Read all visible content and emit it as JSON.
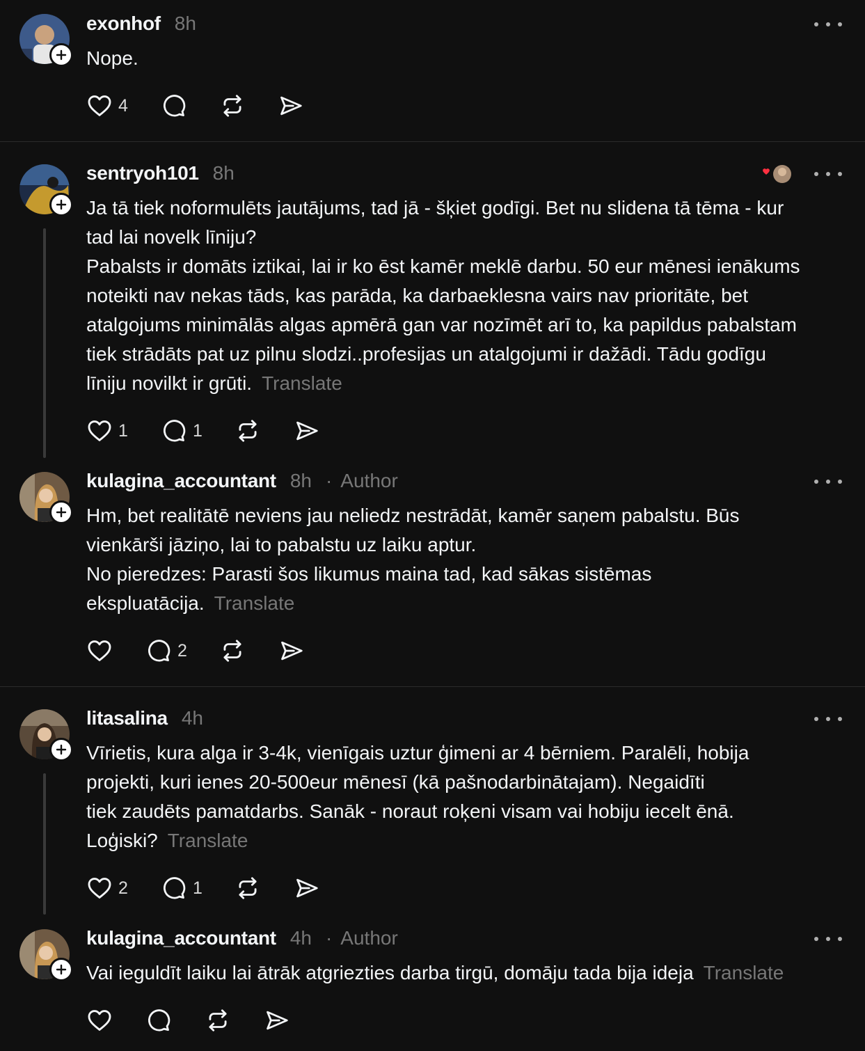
{
  "posts": [
    {
      "username": "exonhof",
      "time": "8h",
      "lines": [
        "Nope."
      ],
      "translate": "",
      "likes": "4",
      "replies": ""
    },
    {
      "username": "sentryoh101",
      "time": "8h",
      "lines": [
        "Ja tā tiek noformulēts jautājums, tad jā - šķiet godīgi. Bet nu slidena tā tēma - kur",
        "tad lai novelk līniju?",
        "Pabalsts ir domāts iztikai, lai ir ko ēst kamēr meklē darbu. 50 eur mēnesi ienākums",
        "noteikti nav nekas tāds, kas parāda, ka darbaeklesna vairs nav prioritāte, bet",
        "atalgojums minimālās algas apmērā gan var nozīmēt arī to, ka papildus pabalstam",
        "tiek strādāts pat uz pilnu slodzi..profesijas un atalgojumi ir dažādi. Tādu godīgu",
        "līniju novilkt ir grūti."
      ],
      "translate": "Translate",
      "likes": "1",
      "replies": "1"
    },
    {
      "username": "kulagina_accountant",
      "time": "8h",
      "author_dot": "·",
      "author_label": "Author",
      "lines": [
        "Hm, bet realitātē neviens jau neliedz nestrādāt, kamēr saņem pabalstu. Būs",
        "vienkārši jāziņo, lai to pabalstu uz laiku aptur.",
        "No pieredzes: Parasti šos likumus maina tad, kad sākas sistēmas",
        "ekspluatācija."
      ],
      "translate": "Translate",
      "likes": "",
      "replies": "2"
    },
    {
      "username": "litasalina",
      "time": "4h",
      "lines": [
        "Vīrietis, kura alga ir 3-4k, vienīgais uztur ģimeni ar 4 bērniem. Paralēli, hobija",
        "projekti, kuri ienes 20-500eur mēnesī (kā pašnodarbinātajam). Negaidīti",
        "tiek zaudēts pamatdarbs. Sanāk - noraut roķeni visam vai hobiju iecelt ēnā.",
        "Loģiski?"
      ],
      "translate": "Translate",
      "likes": "2",
      "replies": "1"
    },
    {
      "username": "kulagina_accountant",
      "time": "4h",
      "author_dot": "·",
      "author_label": "Author",
      "lines": [
        "Vai ieguldīt laiku lai ātrāk atgriezties darba tirgū, domāju tada bija ideja"
      ],
      "translate": "Translate",
      "likes": "",
      "replies": ""
    }
  ],
  "icons": {
    "like": "heart-icon",
    "reply": "comment-icon",
    "repost": "repost-icon",
    "share": "share-icon",
    "more": "more-icon",
    "follow": "plus-icon"
  },
  "colors": {
    "background": "#101010",
    "text": "#f3f5f7",
    "muted": "#777777",
    "liked_heart": "#ff3040"
  }
}
